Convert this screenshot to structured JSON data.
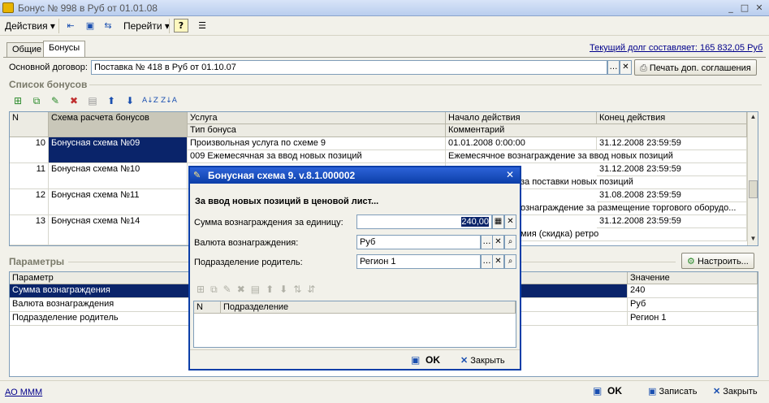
{
  "window": {
    "title": "Бонус № 998 в Руб от 01.01.08"
  },
  "toolbar": {
    "actions_label": "Действия",
    "goto_label": "Перейти",
    "help_label": "?"
  },
  "tabs": [
    {
      "label": "Общие"
    },
    {
      "label": "Бонусы"
    }
  ],
  "debt": {
    "text": "Текущий долг составляет: 165 832,05 Руб"
  },
  "contract": {
    "label": "Основной договор:",
    "value": "Поставка № 418 в Руб от 01.10.07",
    "print_button": "Печать доп. соглашения"
  },
  "bonus_list": {
    "title": "Список бонусов",
    "columns": {
      "n": "N",
      "scheme": "Схема расчета бонусов",
      "service": "Услуга",
      "bonus_type": "Тип бонуса",
      "start": "Начало действия",
      "comment": "Комментарий",
      "end": "Конец действия"
    },
    "rows": [
      {
        "n": "10",
        "scheme": "Бонусная схема №09",
        "service": "Произвольная услуга по схеме 9",
        "type": "009 Ежемесячная за ввод новых позиций",
        "start": "01.01.2008 0:00:00",
        "comment": "Ежемесячное вознаграждение за ввод новых позиций",
        "end": "31.12.2008 23:59:59"
      },
      {
        "n": "11",
        "scheme": "Бонусная схема №10",
        "comment_tail": "за поставки новых позиций",
        "end": "31.12.2008 23:59:59"
      },
      {
        "n": "12",
        "scheme": "Бонусная схема №11",
        "comment_tail": "ознаграждение за размещение торгового оборудо...",
        "end": "31.08.2008 23:59:59"
      },
      {
        "n": "13",
        "scheme": "Бонусная схема №14",
        "comment_tail": "мия (скидка) ретро",
        "end": "31.12.2008 23:59:59"
      }
    ]
  },
  "params": {
    "title": "Параметры",
    "setup_button": "Настроить...",
    "columns": {
      "param": "Параметр",
      "value": "Значение"
    },
    "rows": [
      {
        "param": "Сумма вознаграждения",
        "value": "240"
      },
      {
        "param": "Валюта вознаграждения",
        "value": "Руб"
      },
      {
        "param": "Подразделение родитель",
        "value": "Регион 1"
      }
    ]
  },
  "status": {
    "user": "АО МММ",
    "ok": "OK",
    "save": "Записать",
    "close": "Закрыть"
  },
  "dialog": {
    "title": "Бонусная схема 9. v.8.1.000002",
    "heading": "За ввод новых позиций в ценовой лист...",
    "amount_label": "Сумма вознаграждения за единицу:",
    "amount_value": "240,00",
    "currency_label": "Валюта вознаграждения:",
    "currency_value": "Руб",
    "division_label": "Подразделение родитель:",
    "division_value": "Регион 1",
    "grid_columns": {
      "n": "N",
      "division": "Подразделение"
    },
    "ok": "OK",
    "close": "Закрыть"
  }
}
